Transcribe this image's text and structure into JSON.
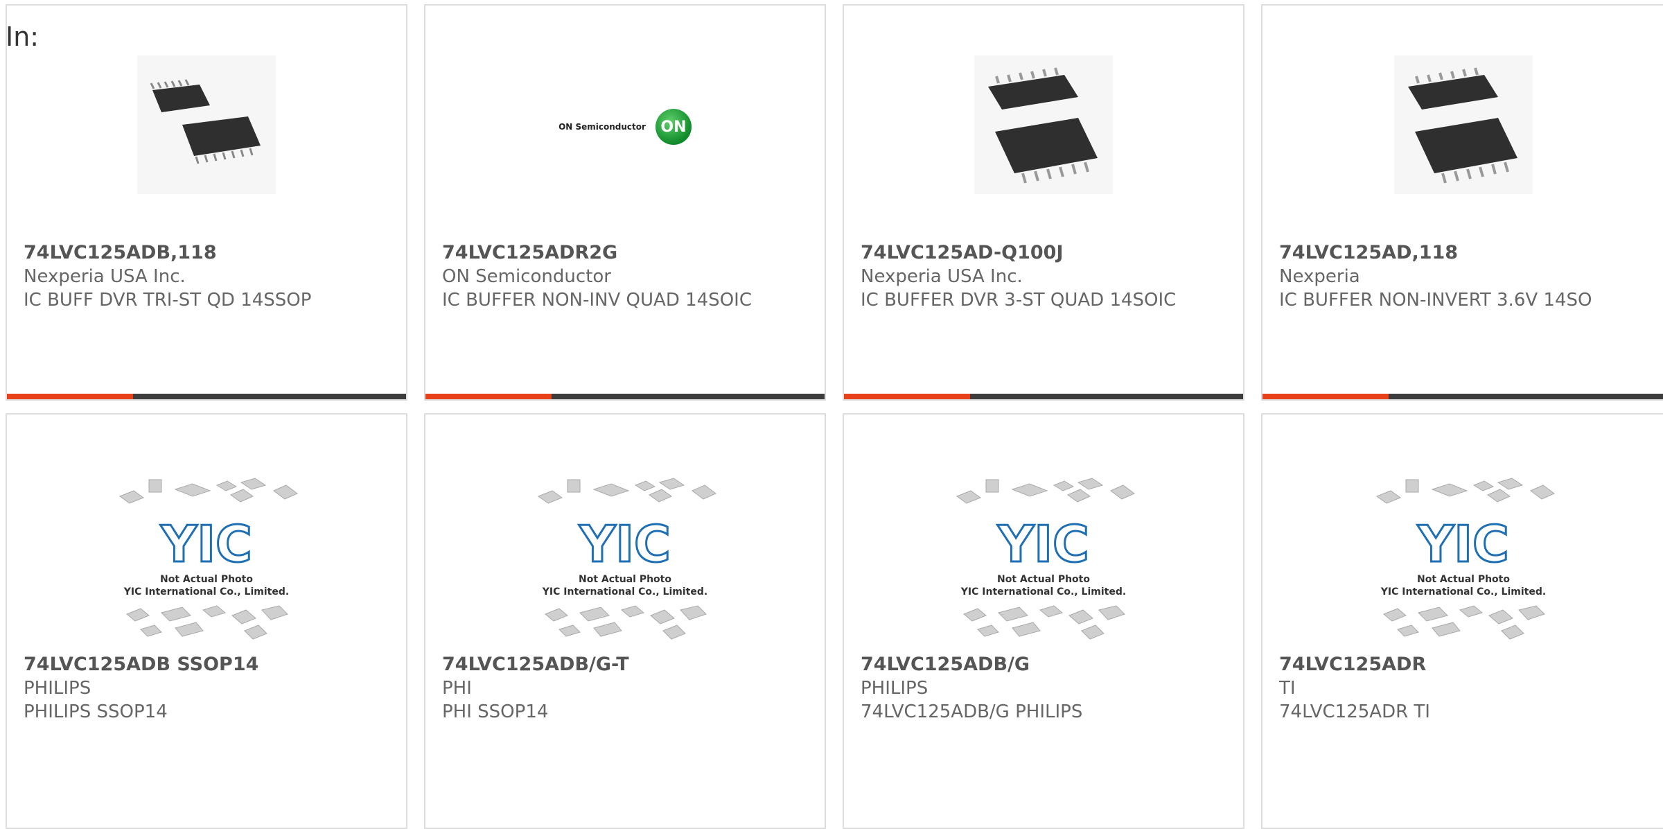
{
  "heading": "In:",
  "colors": {
    "accent": "#e8411a",
    "bar": "#3d3d3d",
    "border": "#dddddd",
    "yic_blue": "#1e6fb3"
  },
  "products": [
    {
      "part": "74LVC125ADB,118",
      "manufacturer": "Nexperia USA Inc.",
      "desc": "IC BUFF DVR TRI-ST QD 14SSOP",
      "image": "ssop-chips-photo"
    },
    {
      "part": "74LVC125ADR2G",
      "manufacturer": "ON Semiconductor",
      "desc": "IC BUFFER NON-INV QUAD 14SOIC",
      "image": "on-semiconductor-logo",
      "logo_text": "ON Semiconductor",
      "logo_badge": "ON"
    },
    {
      "part": "74LVC125AD-Q100J",
      "manufacturer": "Nexperia USA Inc.",
      "desc": "IC BUFFER DVR 3-ST QUAD 14SOIC",
      "image": "soic-chips-photo"
    },
    {
      "part": "74LVC125AD,118",
      "manufacturer": "Nexperia",
      "desc": "IC BUFFER NON-INVERT 3.6V 14SO",
      "image": "soic-chips-photo"
    },
    {
      "part": "74LVC125ADB SSOP14",
      "manufacturer": "PHILIPS",
      "desc": "PHILIPS SSOP14",
      "image": "yic-placeholder"
    },
    {
      "part": "74LVC125ADB/G-T",
      "manufacturer": "PHI",
      "desc": "PHI SSOP14",
      "image": "yic-placeholder"
    },
    {
      "part": "74LVC125ADB/G",
      "manufacturer": "PHILIPS",
      "desc": "74LVC125ADB/G PHILIPS",
      "image": "yic-placeholder"
    },
    {
      "part": "74LVC125ADR",
      "manufacturer": "TI",
      "desc": "74LVC125ADR TI",
      "image": "yic-placeholder"
    }
  ],
  "placeholder": {
    "logo": "YIC",
    "line1": "Not Actual Photo",
    "line2": "YIC International Co., Limited."
  }
}
